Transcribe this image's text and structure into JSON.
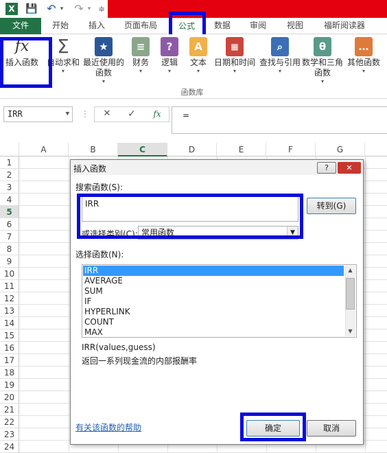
{
  "window": {
    "title": ""
  },
  "quick_access": [
    "X",
    "💾",
    "↶",
    "▾",
    "↷",
    "▾",
    "≑"
  ],
  "tabs": [
    "文件",
    "开始",
    "插入",
    "页面布局",
    "公式",
    "数据",
    "审阅",
    "视图",
    "福昕阅读器"
  ],
  "ribbon": {
    "buttons": [
      {
        "label": "插入函数",
        "icon": "fx-icon"
      },
      {
        "label": "自动求和",
        "icon": "sigma-icon"
      },
      {
        "label": "最近使用的函数",
        "icon": "star-icon"
      },
      {
        "label": "财务",
        "icon": "coins-icon"
      },
      {
        "label": "逻辑",
        "icon": "question-book-icon"
      },
      {
        "label": "文本",
        "icon": "text-book-icon"
      },
      {
        "label": "日期和时间",
        "icon": "calendar-icon"
      },
      {
        "label": "查找与引用",
        "icon": "magnifier-icon"
      },
      {
        "label": "数学和三角函数",
        "icon": "theta-icon"
      },
      {
        "label": "其他函数",
        "icon": "more-icon"
      }
    ],
    "group_label": "函数库"
  },
  "formula_bar": {
    "name_box": "IRR",
    "cancel": "✕",
    "enter": "✓",
    "fx": "fx",
    "content": "="
  },
  "columns": [
    "A",
    "B",
    "C",
    "D",
    "E",
    "F",
    "G"
  ],
  "rows": [
    "1",
    "2",
    "3",
    "4",
    "5",
    "6",
    "7",
    "8",
    "9",
    "10",
    "11",
    "12",
    "13",
    "14",
    "15",
    "16",
    "17",
    "18",
    "19",
    "20",
    "21",
    "22",
    "23",
    "24"
  ],
  "dialog": {
    "title": "插入函数",
    "help_btn": "?",
    "close_btn": "✕",
    "search_label": "搜索函数(S):",
    "search_value": "IRR",
    "goto_button": "转到(G)",
    "category_label": "或选择类别(C):",
    "category_value": "常用函数",
    "select_label": "选择函数(N):",
    "functions": [
      "IRR",
      "AVERAGE",
      "SUM",
      "IF",
      "HYPERLINK",
      "COUNT",
      "MAX"
    ],
    "signature": "IRR(values,guess)",
    "description": "返回一系列现金流的内部报酬率",
    "help_link": "有关该函数的帮助",
    "ok_button": "确定",
    "cancel_button": "取消"
  },
  "colors": {
    "excel_green": "#217346",
    "highlight": "#0a0adb",
    "selection": "#3399ff",
    "title_red": "#e4000f"
  }
}
